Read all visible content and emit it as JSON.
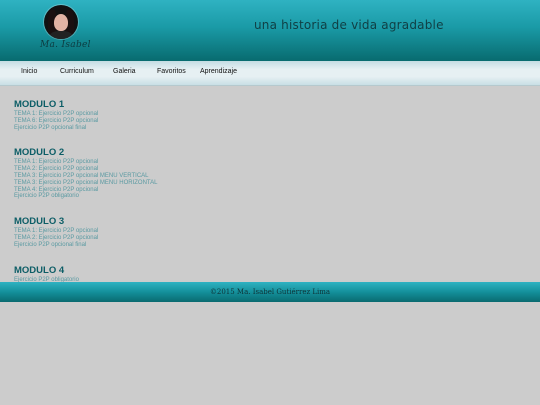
{
  "header": {
    "tagline": "una historia de vida agradable",
    "signature": "Ma. Isabel"
  },
  "nav": {
    "items": [
      "Inicio",
      "Curriculum",
      "Galeria",
      "Favoritos",
      "Aprendizaje"
    ]
  },
  "modules": [
    {
      "title": "MODULO 1",
      "links": [
        "TEMA 1: Ejercicio P2P opcional",
        "TEMA 6: Ejercicio P2P opcional",
        "Ejercicio P2P opcional final"
      ]
    },
    {
      "title": "MODULO 2",
      "links": [
        "TEMA 1: Ejercicio P2P opcional",
        "TEMA 2: Ejercicio P2P opcional",
        "TEMA 3: Ejercicio P2P opcional MENU VERTICAL",
        "TEMA 3: Ejercicio P2P opcional MENU HORIZONTAL",
        "TEMA 4: Ejercicio P2P opcional",
        "Ejercicio P2P obligatorio"
      ]
    },
    {
      "title": "MODULO 3",
      "links": [
        "TEMA 1: Ejercicio P2P opcional",
        "TEMA 2: Ejercicio P2P opcional",
        "Ejercicio P2P opcional final"
      ]
    },
    {
      "title": "MODULO 4",
      "links": [
        "Ejercicio P2P obligatorio"
      ]
    }
  ],
  "footer": {
    "text": "©2015 Ma. Isabel Gutiérrez Lima"
  }
}
